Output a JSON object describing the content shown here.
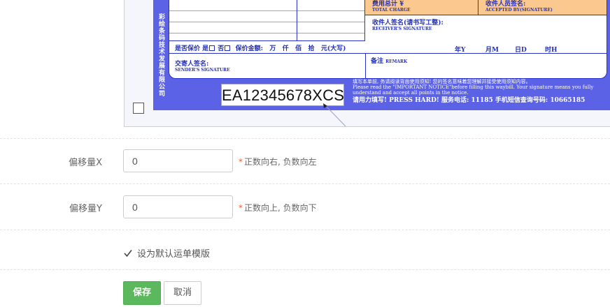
{
  "waybill": {
    "spine_text": "彩绘条码技术发展有限公司",
    "fee_total": {
      "cn": "费用总计 ¥",
      "en": "TOTAL CHARGE"
    },
    "accepted": {
      "cn": "收件人员签名:",
      "en": "ACCEPTED BY(SIGNATURE)"
    },
    "receiver": {
      "cn": "收件人签名(请书写工整):",
      "en": "RECEIVER'S SIGNATURE"
    },
    "insured_row": {
      "prefix": "是否保价 是",
      "no": "否",
      "amount": "保价金额:",
      "units": "万   仟   佰   拾   元(大写)"
    },
    "date_row": {
      "year": "年Y",
      "month": "月M",
      "day": "日D",
      "hour": "时H"
    },
    "sender": {
      "cn": "交寄人签名:",
      "en": "SENDER'S SIGNATURE"
    },
    "remark": {
      "cn": "备注",
      "en": "REMARK"
    },
    "tracking_number": "EA12345678XCS",
    "notice_cn": "填写本单前, 务请阅读背面使用须知! 您的签名意味着您理解并接受使用须知内容。",
    "notice_en": "Please read the \"IMPORTANT NOTICE\"before filling this waybill. Your signature means you fully understand and accept all points in the notice.",
    "press_hard": "请用力填写!   PRESS HARD!   服务电话: 11185   手机短信查询号码: 10665185"
  },
  "form": {
    "offset_x": {
      "label": "偏移量X",
      "value": "0",
      "hint": "正数向右, 负数向左"
    },
    "offset_y": {
      "label": "偏移量Y",
      "value": "0",
      "hint": "正数向上, 负数向下"
    },
    "hint_star": "*",
    "default_template": {
      "label": "设为默认运单模版",
      "checked": true
    },
    "save_label": "保存",
    "cancel_label": "取消"
  }
}
